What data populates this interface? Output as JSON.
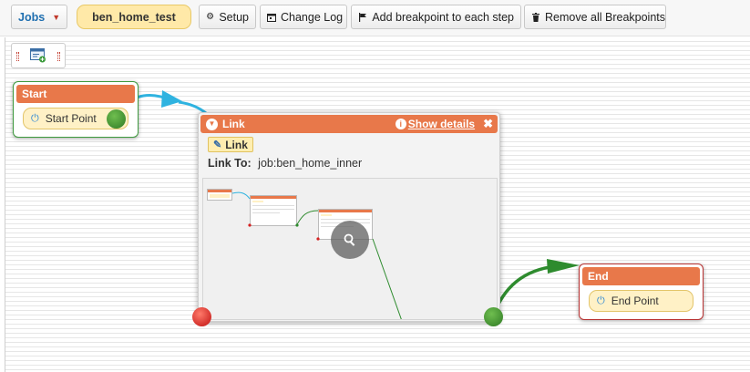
{
  "toolbar": {
    "jobs_label": "Jobs",
    "job_name": "ben_home_test",
    "setup_label": "Setup",
    "changelog_label": "Change Log",
    "add_breakpoint_label": "Add breakpoint to each step",
    "remove_breakpoints_label": "Remove all Breakpoints"
  },
  "nodes": {
    "start": {
      "title": "Start",
      "item": "Start Point"
    },
    "link": {
      "title": "Link",
      "show_details": "Show details",
      "badge": "Link",
      "link_to_label": "Link To:",
      "link_to_value": "job:ben_home_inner"
    },
    "end": {
      "title": "End",
      "item": "End Point"
    }
  },
  "colors": {
    "header": "#e8784a",
    "pill": "#fff1c6",
    "success_port": "#3f8f2f",
    "error_port": "#d62020",
    "flow_blue": "#2fb3e0",
    "flow_green": "#2e8b2e"
  },
  "icons": [
    "caret-down-icon",
    "gear-icon",
    "calendar-icon",
    "flag-icon",
    "trash-icon",
    "add-step-icon",
    "power-icon",
    "collapse-icon",
    "info-icon",
    "close-icon",
    "pencil-icon",
    "zoom-icon"
  ]
}
